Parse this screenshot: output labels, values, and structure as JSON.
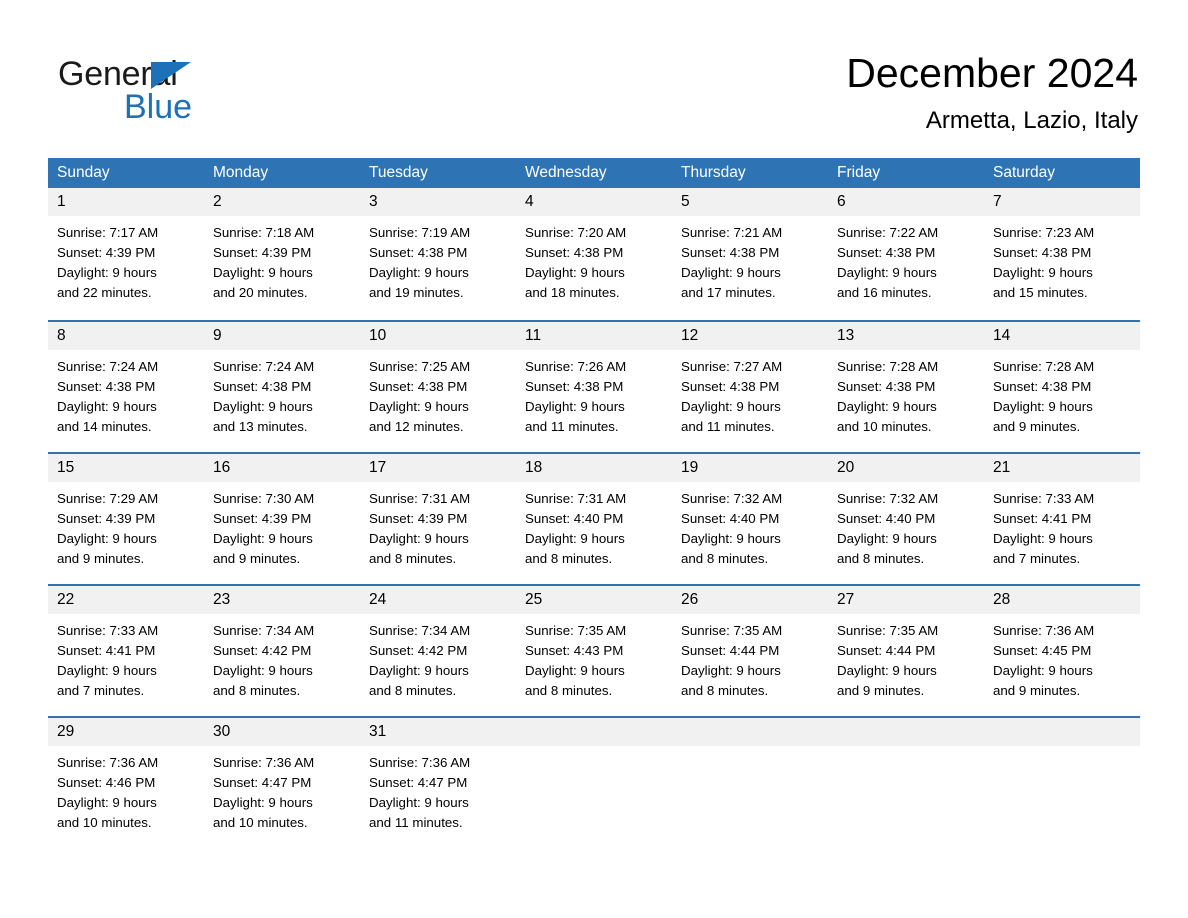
{
  "brand": {
    "name_part1": "General",
    "name_part2": "Blue",
    "accent_color": "#1D71B8"
  },
  "header": {
    "month_title": "December 2024",
    "location": "Armetta, Lazio, Italy"
  },
  "theme": {
    "header_blue": "#2E74B5",
    "day_band_gray": "#F1F1F1",
    "text_black": "#000000"
  },
  "calendar": {
    "weekdays": [
      "Sunday",
      "Monday",
      "Tuesday",
      "Wednesday",
      "Thursday",
      "Friday",
      "Saturday"
    ],
    "weeks": [
      [
        {
          "day": "1",
          "sunrise": "Sunrise: 7:17 AM",
          "sunset": "Sunset: 4:39 PM",
          "daylight_line1": "Daylight: 9 hours",
          "daylight_line2": "and 22 minutes."
        },
        {
          "day": "2",
          "sunrise": "Sunrise: 7:18 AM",
          "sunset": "Sunset: 4:39 PM",
          "daylight_line1": "Daylight: 9 hours",
          "daylight_line2": "and 20 minutes."
        },
        {
          "day": "3",
          "sunrise": "Sunrise: 7:19 AM",
          "sunset": "Sunset: 4:38 PM",
          "daylight_line1": "Daylight: 9 hours",
          "daylight_line2": "and 19 minutes."
        },
        {
          "day": "4",
          "sunrise": "Sunrise: 7:20 AM",
          "sunset": "Sunset: 4:38 PM",
          "daylight_line1": "Daylight: 9 hours",
          "daylight_line2": "and 18 minutes."
        },
        {
          "day": "5",
          "sunrise": "Sunrise: 7:21 AM",
          "sunset": "Sunset: 4:38 PM",
          "daylight_line1": "Daylight: 9 hours",
          "daylight_line2": "and 17 minutes."
        },
        {
          "day": "6",
          "sunrise": "Sunrise: 7:22 AM",
          "sunset": "Sunset: 4:38 PM",
          "daylight_line1": "Daylight: 9 hours",
          "daylight_line2": "and 16 minutes."
        },
        {
          "day": "7",
          "sunrise": "Sunrise: 7:23 AM",
          "sunset": "Sunset: 4:38 PM",
          "daylight_line1": "Daylight: 9 hours",
          "daylight_line2": "and 15 minutes."
        }
      ],
      [
        {
          "day": "8",
          "sunrise": "Sunrise: 7:24 AM",
          "sunset": "Sunset: 4:38 PM",
          "daylight_line1": "Daylight: 9 hours",
          "daylight_line2": "and 14 minutes."
        },
        {
          "day": "9",
          "sunrise": "Sunrise: 7:24 AM",
          "sunset": "Sunset: 4:38 PM",
          "daylight_line1": "Daylight: 9 hours",
          "daylight_line2": "and 13 minutes."
        },
        {
          "day": "10",
          "sunrise": "Sunrise: 7:25 AM",
          "sunset": "Sunset: 4:38 PM",
          "daylight_line1": "Daylight: 9 hours",
          "daylight_line2": "and 12 minutes."
        },
        {
          "day": "11",
          "sunrise": "Sunrise: 7:26 AM",
          "sunset": "Sunset: 4:38 PM",
          "daylight_line1": "Daylight: 9 hours",
          "daylight_line2": "and 11 minutes."
        },
        {
          "day": "12",
          "sunrise": "Sunrise: 7:27 AM",
          "sunset": "Sunset: 4:38 PM",
          "daylight_line1": "Daylight: 9 hours",
          "daylight_line2": "and 11 minutes."
        },
        {
          "day": "13",
          "sunrise": "Sunrise: 7:28 AM",
          "sunset": "Sunset: 4:38 PM",
          "daylight_line1": "Daylight: 9 hours",
          "daylight_line2": "and 10 minutes."
        },
        {
          "day": "14",
          "sunrise": "Sunrise: 7:28 AM",
          "sunset": "Sunset: 4:38 PM",
          "daylight_line1": "Daylight: 9 hours",
          "daylight_line2": "and 9 minutes."
        }
      ],
      [
        {
          "day": "15",
          "sunrise": "Sunrise: 7:29 AM",
          "sunset": "Sunset: 4:39 PM",
          "daylight_line1": "Daylight: 9 hours",
          "daylight_line2": "and 9 minutes."
        },
        {
          "day": "16",
          "sunrise": "Sunrise: 7:30 AM",
          "sunset": "Sunset: 4:39 PM",
          "daylight_line1": "Daylight: 9 hours",
          "daylight_line2": "and 9 minutes."
        },
        {
          "day": "17",
          "sunrise": "Sunrise: 7:31 AM",
          "sunset": "Sunset: 4:39 PM",
          "daylight_line1": "Daylight: 9 hours",
          "daylight_line2": "and 8 minutes."
        },
        {
          "day": "18",
          "sunrise": "Sunrise: 7:31 AM",
          "sunset": "Sunset: 4:40 PM",
          "daylight_line1": "Daylight: 9 hours",
          "daylight_line2": "and 8 minutes."
        },
        {
          "day": "19",
          "sunrise": "Sunrise: 7:32 AM",
          "sunset": "Sunset: 4:40 PM",
          "daylight_line1": "Daylight: 9 hours",
          "daylight_line2": "and 8 minutes."
        },
        {
          "day": "20",
          "sunrise": "Sunrise: 7:32 AM",
          "sunset": "Sunset: 4:40 PM",
          "daylight_line1": "Daylight: 9 hours",
          "daylight_line2": "and 8 minutes."
        },
        {
          "day": "21",
          "sunrise": "Sunrise: 7:33 AM",
          "sunset": "Sunset: 4:41 PM",
          "daylight_line1": "Daylight: 9 hours",
          "daylight_line2": "and 7 minutes."
        }
      ],
      [
        {
          "day": "22",
          "sunrise": "Sunrise: 7:33 AM",
          "sunset": "Sunset: 4:41 PM",
          "daylight_line1": "Daylight: 9 hours",
          "daylight_line2": "and 7 minutes."
        },
        {
          "day": "23",
          "sunrise": "Sunrise: 7:34 AM",
          "sunset": "Sunset: 4:42 PM",
          "daylight_line1": "Daylight: 9 hours",
          "daylight_line2": "and 8 minutes."
        },
        {
          "day": "24",
          "sunrise": "Sunrise: 7:34 AM",
          "sunset": "Sunset: 4:42 PM",
          "daylight_line1": "Daylight: 9 hours",
          "daylight_line2": "and 8 minutes."
        },
        {
          "day": "25",
          "sunrise": "Sunrise: 7:35 AM",
          "sunset": "Sunset: 4:43 PM",
          "daylight_line1": "Daylight: 9 hours",
          "daylight_line2": "and 8 minutes."
        },
        {
          "day": "26",
          "sunrise": "Sunrise: 7:35 AM",
          "sunset": "Sunset: 4:44 PM",
          "daylight_line1": "Daylight: 9 hours",
          "daylight_line2": "and 8 minutes."
        },
        {
          "day": "27",
          "sunrise": "Sunrise: 7:35 AM",
          "sunset": "Sunset: 4:44 PM",
          "daylight_line1": "Daylight: 9 hours",
          "daylight_line2": "and 9 minutes."
        },
        {
          "day": "28",
          "sunrise": "Sunrise: 7:36 AM",
          "sunset": "Sunset: 4:45 PM",
          "daylight_line1": "Daylight: 9 hours",
          "daylight_line2": "and 9 minutes."
        }
      ],
      [
        {
          "day": "29",
          "sunrise": "Sunrise: 7:36 AM",
          "sunset": "Sunset: 4:46 PM",
          "daylight_line1": "Daylight: 9 hours",
          "daylight_line2": "and 10 minutes."
        },
        {
          "day": "30",
          "sunrise": "Sunrise: 7:36 AM",
          "sunset": "Sunset: 4:47 PM",
          "daylight_line1": "Daylight: 9 hours",
          "daylight_line2": "and 10 minutes."
        },
        {
          "day": "31",
          "sunrise": "Sunrise: 7:36 AM",
          "sunset": "Sunset: 4:47 PM",
          "daylight_line1": "Daylight: 9 hours",
          "daylight_line2": "and 11 minutes."
        },
        {
          "day": "",
          "sunrise": "",
          "sunset": "",
          "daylight_line1": "",
          "daylight_line2": ""
        },
        {
          "day": "",
          "sunrise": "",
          "sunset": "",
          "daylight_line1": "",
          "daylight_line2": ""
        },
        {
          "day": "",
          "sunrise": "",
          "sunset": "",
          "daylight_line1": "",
          "daylight_line2": ""
        },
        {
          "day": "",
          "sunrise": "",
          "sunset": "",
          "daylight_line1": "",
          "daylight_line2": ""
        }
      ]
    ]
  }
}
